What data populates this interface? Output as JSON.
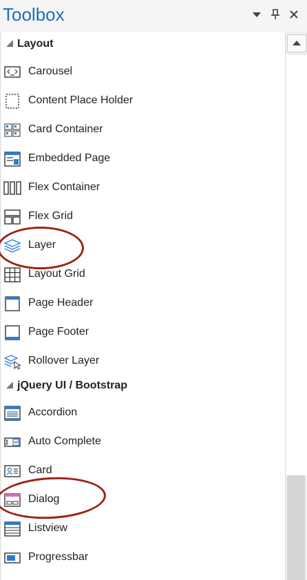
{
  "window": {
    "title": "Toolbox"
  },
  "titlebar_icons": [
    "dropdown-arrow-icon",
    "pin-icon",
    "close-icon"
  ],
  "groups": [
    {
      "label": "Layout",
      "items": [
        {
          "label": "Carousel",
          "icon": "carousel-icon"
        },
        {
          "label": "Content Place Holder",
          "icon": "content-placeholder-icon"
        },
        {
          "label": "Card Container",
          "icon": "card-container-icon"
        },
        {
          "label": "Embedded Page",
          "icon": "embedded-page-icon"
        },
        {
          "label": "Flex Container",
          "icon": "flex-container-icon"
        },
        {
          "label": "Flex Grid",
          "icon": "flex-grid-icon"
        },
        {
          "label": "Layer",
          "icon": "layer-icon"
        },
        {
          "label": "Layout Grid",
          "icon": "layout-grid-icon"
        },
        {
          "label": "Page Header",
          "icon": "page-header-icon"
        },
        {
          "label": "Page Footer",
          "icon": "page-footer-icon"
        },
        {
          "label": "Rollover Layer",
          "icon": "rollover-layer-icon"
        }
      ]
    },
    {
      "label": "jQuery UI / Bootstrap",
      "items": [
        {
          "label": "Accordion",
          "icon": "accordion-icon"
        },
        {
          "label": "Auto Complete",
          "icon": "auto-complete-icon"
        },
        {
          "label": "Card",
          "icon": "card-icon"
        },
        {
          "label": "Dialog",
          "icon": "dialog-icon"
        },
        {
          "label": "Listview",
          "icon": "listview-icon"
        },
        {
          "label": "Progressbar",
          "icon": "progressbar-icon"
        }
      ]
    }
  ],
  "colors": {
    "title": "#1e6fb8",
    "annotation": "#9b2317",
    "icon_blue": "#2b7cd3"
  }
}
